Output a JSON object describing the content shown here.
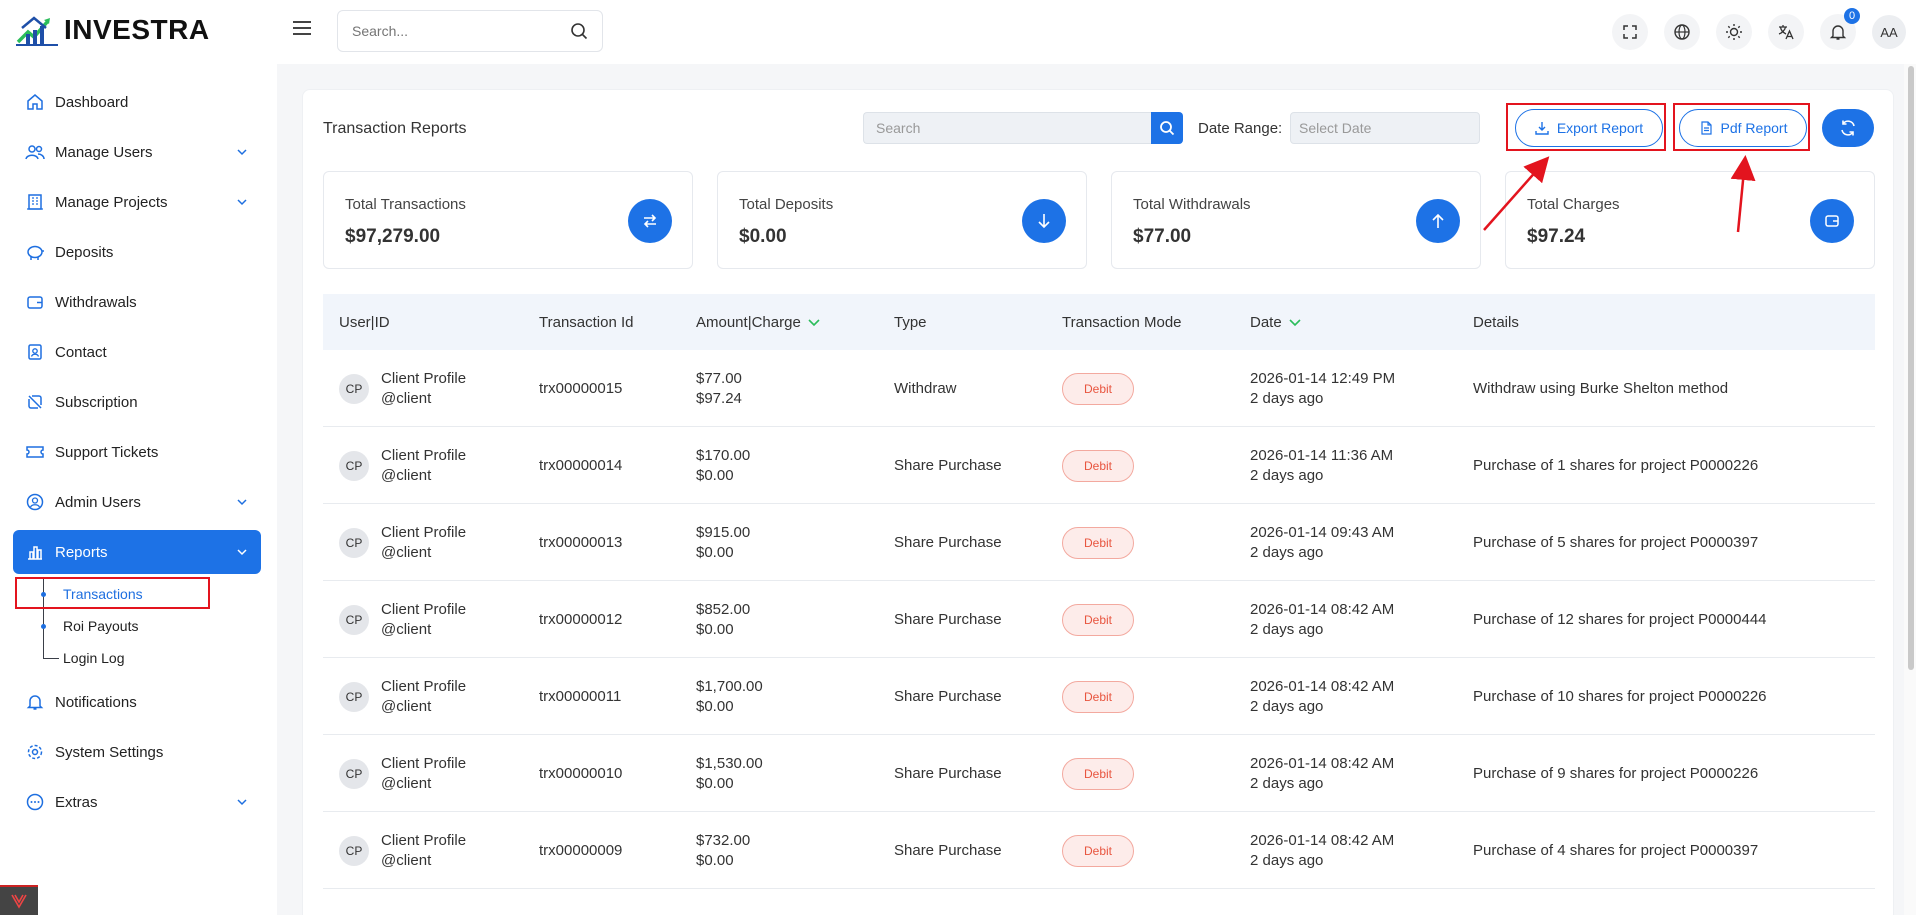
{
  "brand": {
    "name": "INVESTRA"
  },
  "topbar": {
    "search_placeholder": "Search...",
    "notification_count": "0",
    "avatar_initials": "AA"
  },
  "sidebar": {
    "items": [
      {
        "label": "Dashboard",
        "icon": "home-icon"
      },
      {
        "label": "Manage Users",
        "icon": "users-icon"
      },
      {
        "label": "Manage Projects",
        "icon": "building-icon"
      },
      {
        "label": "Deposits",
        "icon": "piggy-bank-icon"
      },
      {
        "label": "Withdrawals",
        "icon": "wallet-icon"
      },
      {
        "label": "Contact",
        "icon": "contact-icon"
      },
      {
        "label": "Subscription",
        "icon": "subscription-icon"
      },
      {
        "label": "Support Tickets",
        "icon": "ticket-icon"
      },
      {
        "label": "Admin Users",
        "icon": "admin-user-icon"
      },
      {
        "label": "Reports",
        "icon": "bar-chart-icon"
      },
      {
        "label": "Notifications",
        "icon": "bell-icon"
      },
      {
        "label": "System Settings",
        "icon": "gear-icon"
      },
      {
        "label": "Extras",
        "icon": "more-icon"
      }
    ],
    "reports_sub": [
      "Transactions",
      "Roi Payouts",
      "Login Log"
    ]
  },
  "page": {
    "title": "Transaction Reports",
    "search_placeholder": "Search",
    "date_range_label": "Date Range:",
    "date_placeholder": "Select Date",
    "export_label": "Export Report",
    "pdf_label": "Pdf Report"
  },
  "stats": [
    {
      "label": "Total Transactions",
      "value": "$97,279.00",
      "icon": "swap-icon"
    },
    {
      "label": "Total Deposits",
      "value": "$0.00",
      "icon": "arrow-down-icon"
    },
    {
      "label": "Total Withdrawals",
      "value": "$77.00",
      "icon": "arrow-up-icon"
    },
    {
      "label": "Total Charges",
      "value": "$97.24",
      "icon": "wallet-icon"
    }
  ],
  "table": {
    "headers": [
      "User|ID",
      "Transaction Id",
      "Amount|Charge",
      "Type",
      "Transaction Mode",
      "Date",
      "Details"
    ],
    "rows": [
      {
        "initials": "CP",
        "name": "Client Profile",
        "user": "@client",
        "trx": "trx00000015",
        "amount": "$77.00",
        "charge": "$97.24",
        "type": "Withdraw",
        "mode": "Debit",
        "date": "2026-01-14 12:49 PM",
        "ago": "2 days ago",
        "details": "Withdraw using Burke Shelton method"
      },
      {
        "initials": "CP",
        "name": "Client Profile",
        "user": "@client",
        "trx": "trx00000014",
        "amount": "$170.00",
        "charge": "$0.00",
        "type": "Share Purchase",
        "mode": "Debit",
        "date": "2026-01-14 11:36 AM",
        "ago": "2 days ago",
        "details": "Purchase of 1 shares for project P0000226"
      },
      {
        "initials": "CP",
        "name": "Client Profile",
        "user": "@client",
        "trx": "trx00000013",
        "amount": "$915.00",
        "charge": "$0.00",
        "type": "Share Purchase",
        "mode": "Debit",
        "date": "2026-01-14 09:43 AM",
        "ago": "2 days ago",
        "details": "Purchase of 5 shares for project P0000397"
      },
      {
        "initials": "CP",
        "name": "Client Profile",
        "user": "@client",
        "trx": "trx00000012",
        "amount": "$852.00",
        "charge": "$0.00",
        "type": "Share Purchase",
        "mode": "Debit",
        "date": "2026-01-14 08:42 AM",
        "ago": "2 days ago",
        "details": "Purchase of 12 shares for project P0000444"
      },
      {
        "initials": "CP",
        "name": "Client Profile",
        "user": "@client",
        "trx": "trx00000011",
        "amount": "$1,700.00",
        "charge": "$0.00",
        "type": "Share Purchase",
        "mode": "Debit",
        "date": "2026-01-14 08:42 AM",
        "ago": "2 days ago",
        "details": "Purchase of 10 shares for project P0000226"
      },
      {
        "initials": "CP",
        "name": "Client Profile",
        "user": "@client",
        "trx": "trx00000010",
        "amount": "$1,530.00",
        "charge": "$0.00",
        "type": "Share Purchase",
        "mode": "Debit",
        "date": "2026-01-14 08:42 AM",
        "ago": "2 days ago",
        "details": "Purchase of 9 shares for project P0000226"
      },
      {
        "initials": "CP",
        "name": "Client Profile",
        "user": "@client",
        "trx": "trx00000009",
        "amount": "$732.00",
        "charge": "$0.00",
        "type": "Share Purchase",
        "mode": "Debit",
        "date": "2026-01-14 08:42 AM",
        "ago": "2 days ago",
        "details": "Purchase of 4 shares for project P0000397"
      }
    ]
  },
  "colors": {
    "accent": "#1d72e6",
    "debit_text": "#e8553f",
    "debit_bg": "#fdecea",
    "annotation": "#e3141e"
  }
}
